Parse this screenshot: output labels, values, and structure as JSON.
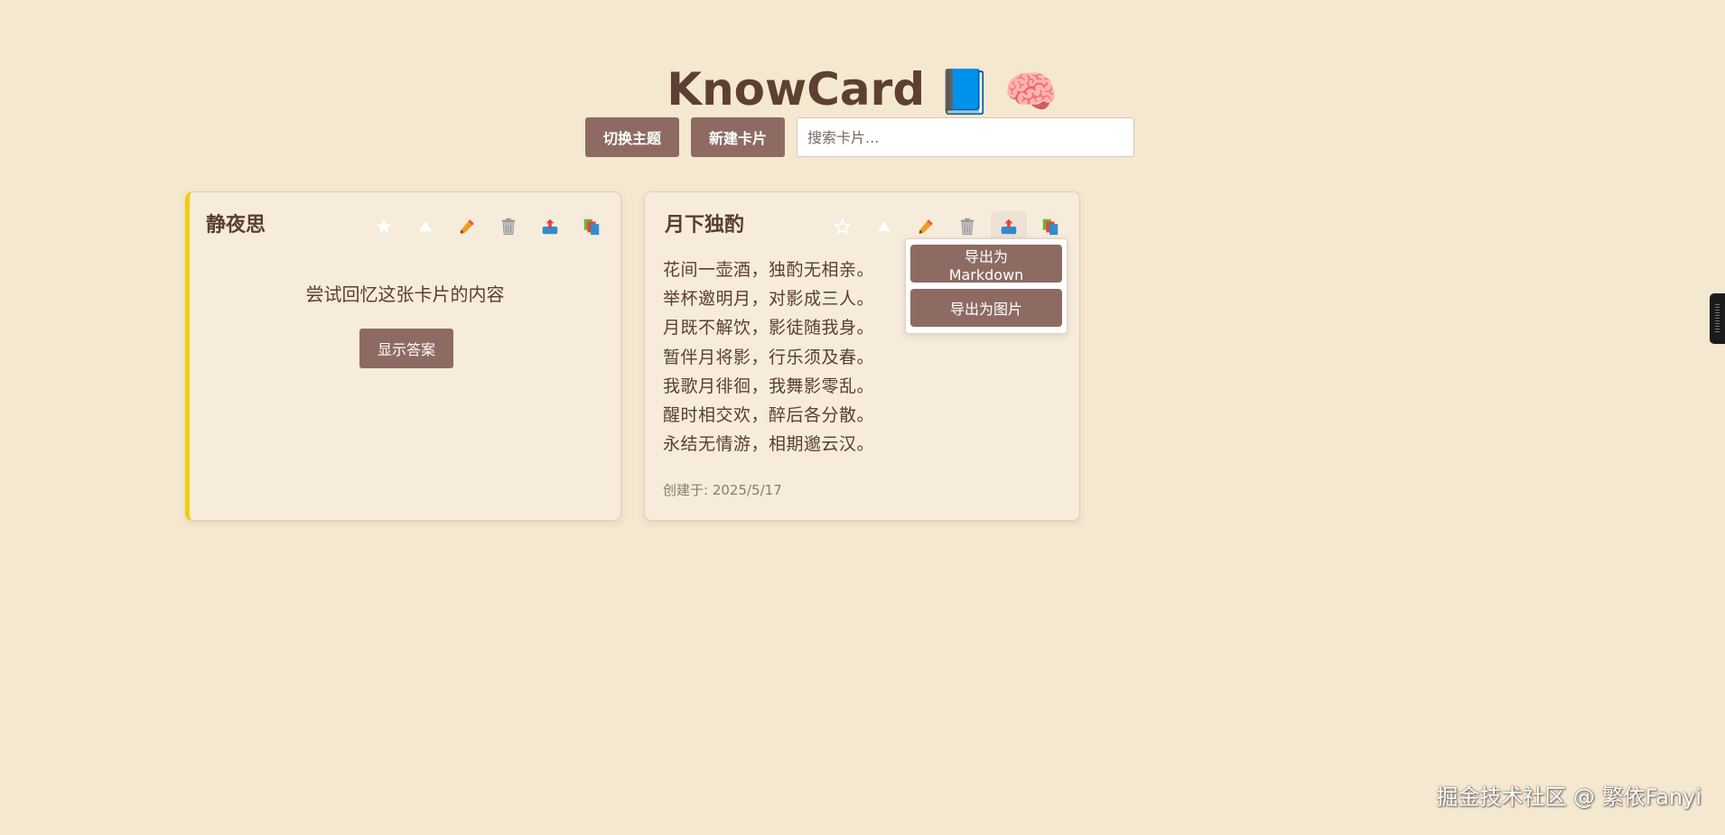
{
  "app": {
    "title": "KnowCard",
    "title_emojis": [
      "📘",
      "🧠"
    ]
  },
  "toolbar": {
    "toggle_theme_label": "切换主题",
    "new_card_label": "新建卡片",
    "search_placeholder": "搜索卡片..."
  },
  "cards": [
    {
      "title": "静夜思",
      "mode": "recall",
      "accent_color": "#f2cc0e",
      "starred": true,
      "recall_prompt": "尝试回忆这张卡片的内容",
      "show_answer_label": "显示答案",
      "actions": [
        "star-icon",
        "triangle-icon",
        "pencil-icon",
        "trash-icon",
        "export-icon",
        "copy-icon"
      ]
    },
    {
      "title": "月下独酌",
      "mode": "content",
      "starred": false,
      "lines": [
        "花间一壶酒，独酌无相亲。",
        "举杯邀明月，对影成三人。",
        "月既不解饮，影徒随我身。",
        "暂伴月将影，行乐须及春。",
        "我歌月徘徊，我舞影零乱。",
        "醒时相交欢，醉后各分散。",
        "永结无情游，相期邈云汉。"
      ],
      "created_label": "创建于: 2025/5/17",
      "actions": [
        "star-outline-icon",
        "triangle-icon",
        "pencil-icon",
        "trash-icon",
        "export-icon",
        "copy-icon"
      ]
    }
  ],
  "export_menu": {
    "markdown_label": "导出为Markdown",
    "image_label": "导出为图片"
  },
  "watermark": "掘金技术社区 @ 繁依Fanyi",
  "colors": {
    "background": "#f5e8d0",
    "button": "#8d6b63",
    "card": "#f7ecdb",
    "text": "#5a3e31"
  }
}
